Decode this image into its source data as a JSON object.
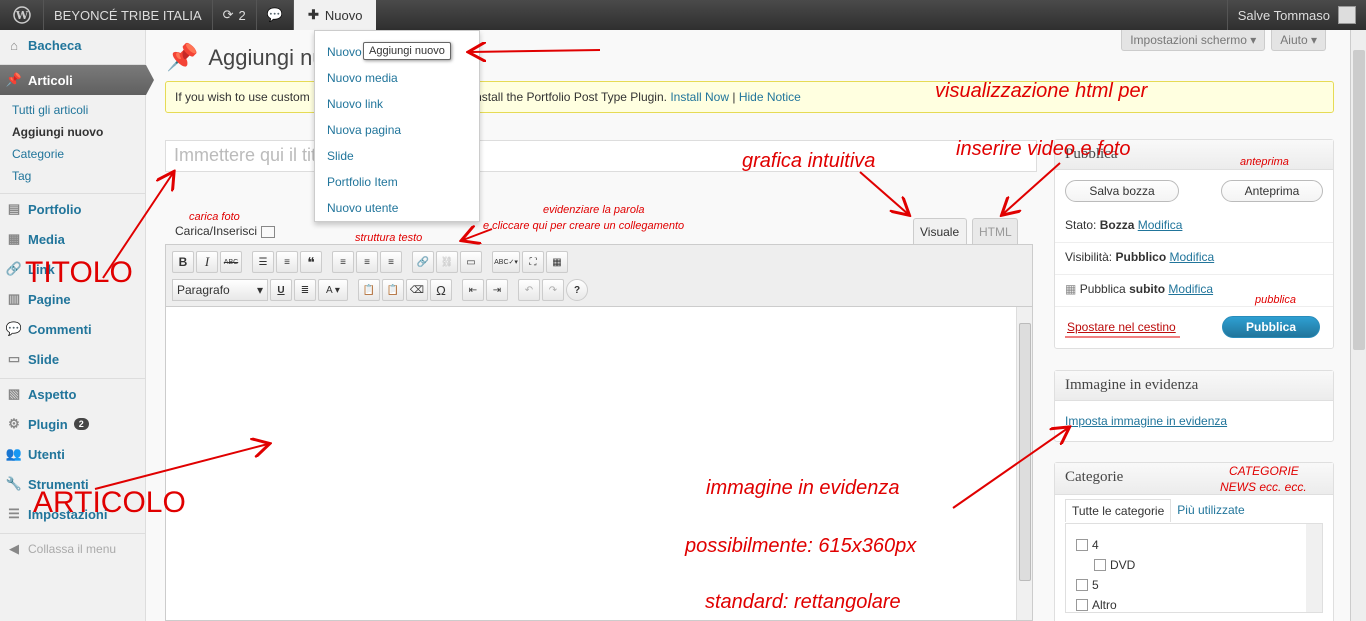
{
  "adminbar": {
    "site_name": "BEYONCÉ TRIBE ITALIA",
    "updates_count": "2",
    "new_label": "Nuovo",
    "greeting": "Salve Tommaso"
  },
  "new_menu": {
    "items": [
      "Nuovo articolo",
      "Nuovo media",
      "Nuovo link",
      "Nuova pagina",
      "Slide",
      "Portfolio Item",
      "Nuovo utente"
    ],
    "tooltip": "Aggiungi nuovo"
  },
  "sidebar": {
    "dashboard": "Bacheca",
    "posts": "Articoli",
    "posts_sub": [
      "Tutti gli articoli",
      "Aggiungi nuovo",
      "Categorie",
      "Tag"
    ],
    "portfolio": "Portfolio",
    "media": "Media",
    "links": "Link",
    "pages": "Pagine",
    "comments": "Commenti",
    "slides": "Slide",
    "appearance": "Aspetto",
    "plugins": "Plugin",
    "plugins_badge": "2",
    "users": "Utenti",
    "tools": "Strumenti",
    "settings": "Impostazioni",
    "collapse": "Collassa il menu"
  },
  "header": {
    "screen_options": "Impostazioni schermo",
    "help": "Aiuto",
    "page_title": "Aggiungi nuovo articolo"
  },
  "notice": {
    "text_start": "If you wish to use custom",
    "text_end": "e install the Portfolio Post Type Plugin.",
    "install_link": "Install Now",
    "separator": "|",
    "hide_link": "Hide Notice"
  },
  "editor": {
    "title_placeholder": "Immettere qui il titolo",
    "upload_label": "Carica/Inserisci",
    "tab_visual": "Visuale",
    "tab_html": "HTML",
    "format_select": "Paragrafo"
  },
  "publish_box": {
    "title": "Pubblica",
    "save_draft": "Salva bozza",
    "preview": "Anteprima",
    "status_label": "Stato:",
    "status_value": "Bozza",
    "visibility_label": "Visibilità:",
    "visibility_value": "Pubblico",
    "publish_label": "Pubblica",
    "publish_value": "subito",
    "edit_link": "Modifica",
    "trash": "Spostare nel cestino",
    "publish_button": "Pubblica"
  },
  "featured_box": {
    "title": "Immagine in evidenza",
    "link": "Imposta immagine in evidenza"
  },
  "category_box": {
    "title": "Categorie",
    "tab_all": "Tutte le categorie",
    "tab_popular": "Più utilizzate",
    "items": [
      "4",
      "DVD",
      "5",
      "Altro"
    ]
  },
  "annotations": {
    "visualizzazione": "visualizzazione html per",
    "inserire": "inserire video e foto",
    "grafica": "grafica intuitiva",
    "anteprima": "anteprima",
    "pubblica": "pubblica",
    "carica_foto": "carica foto",
    "evidenziare_1": "evidenziare la parola",
    "evidenziare_2": "e cliccare qui per creare un collegamento",
    "struttura": "struttura testo",
    "titolo": "TITOLO",
    "articolo": "ARTICOLO",
    "immagine": "immagine in evidenza",
    "possibilmente": "possibilmente: 615x360px",
    "standard": "standard: rettangolare",
    "categorie_1": "CATEGORIE",
    "categorie_2": "NEWS ecc. ecc."
  },
  "colors": {
    "link": "#21759b",
    "annotation": "#e00000",
    "admin_bar": "#464646",
    "publish_button": "#21759b"
  }
}
